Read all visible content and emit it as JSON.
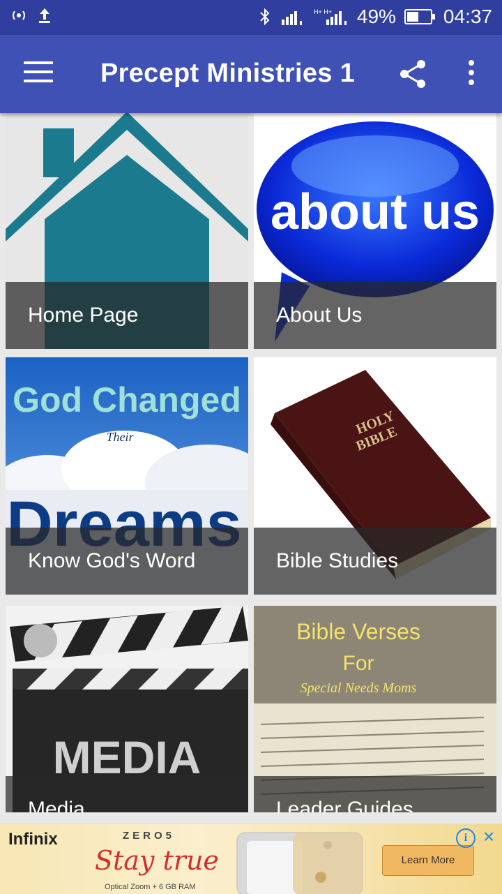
{
  "status_bar": {
    "battery_percent": "49%",
    "time": "04:37"
  },
  "app_bar": {
    "title": "Precept Ministries 1"
  },
  "tiles": [
    {
      "label": "Home Page",
      "image_text": ""
    },
    {
      "label": "About Us",
      "image_text": "about us"
    },
    {
      "label": "Know God's Word",
      "image_text_line1": "God Changed",
      "image_text_line2": "Their",
      "image_text_line3": "Dreams"
    },
    {
      "label": "Bible Studies",
      "image_text_line1": "HOLY",
      "image_text_line2": "BIBLE"
    },
    {
      "label": "Media",
      "image_text": "MEDIA"
    },
    {
      "label": "Leader Guides",
      "image_text_line1": "Bible Verses",
      "image_text_line2": "For",
      "image_text_line3": "Special Needs Moms"
    }
  ],
  "ad": {
    "brand": "Infinix",
    "product": "ZERO5",
    "tagline": "Stay true",
    "subtext": "Optical Zoom + 6 GB RAM",
    "cta": "Learn More"
  },
  "colors": {
    "status_bar": "#303f9f",
    "app_bar": "#3f51b5",
    "caption_overlay": "rgba(40,40,40,0.72)"
  }
}
